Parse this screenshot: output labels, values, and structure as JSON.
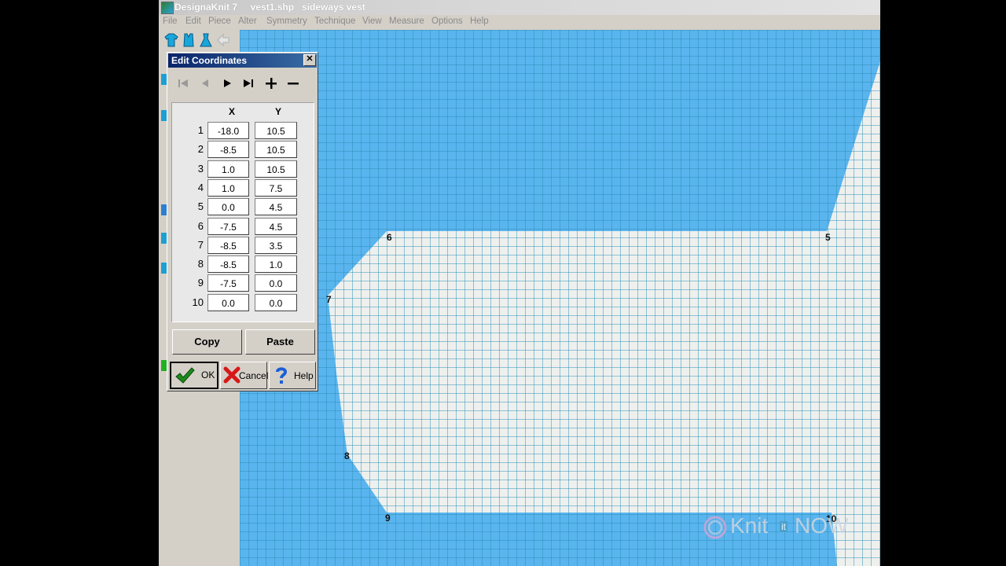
{
  "window": {
    "title": "DesignaKnit 7     vest1.shp   sideways vest"
  },
  "menu": [
    "File",
    "Edit",
    "Piece",
    "Alter",
    "Symmetry",
    "Technique",
    "View",
    "Measure",
    "Options",
    "Help"
  ],
  "dialog": {
    "title": "Edit Coordinates",
    "close_glyph": "✕",
    "nav": {
      "first_icon": "first-record-icon",
      "prev_icon": "previous-record-icon",
      "next_icon": "next-record-icon",
      "last_icon": "last-record-icon",
      "add_icon": "add-point-icon",
      "remove_icon": "remove-point-icon"
    },
    "columns": [
      "X",
      "Y"
    ],
    "rows": [
      {
        "n": "1",
        "x": "-18.0",
        "y": "10.5"
      },
      {
        "n": "2",
        "x": "-8.5",
        "y": "10.5"
      },
      {
        "n": "3",
        "x": "1.0",
        "y": "10.5"
      },
      {
        "n": "4",
        "x": "1.0",
        "y": "7.5"
      },
      {
        "n": "5",
        "x": "0.0",
        "y": "4.5"
      },
      {
        "n": "6",
        "x": "-7.5",
        "y": "4.5"
      },
      {
        "n": "7",
        "x": "-8.5",
        "y": "3.5"
      },
      {
        "n": "8",
        "x": "-8.5",
        "y": "1.0"
      },
      {
        "n": "9",
        "x": "-7.5",
        "y": "0.0"
      },
      {
        "n": "10",
        "x": "0.0",
        "y": "0.0"
      }
    ],
    "copy_label": "Copy",
    "paste_label": "Paste",
    "ok_label": "OK",
    "cancel_label": "Cancel",
    "help_label": "Help"
  },
  "canvas": {
    "point_labels": [
      "6",
      "5",
      "7",
      "8",
      "9",
      "10"
    ],
    "colors": {
      "background": "#5ab4ee",
      "piece": "#eef0ee",
      "grid": "#2a8fb8"
    }
  },
  "watermark": {
    "text_a": "Knit",
    "text_b": "it",
    "text_c": "NOW"
  }
}
